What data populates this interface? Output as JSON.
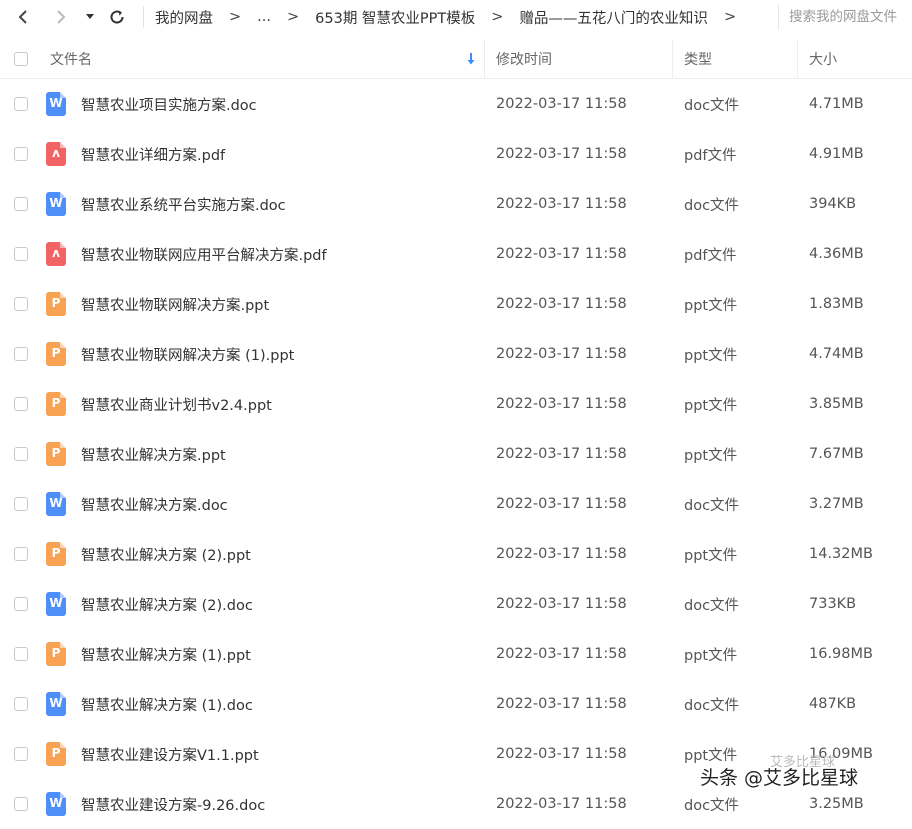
{
  "toolbar": {
    "breadcrumbs": [
      "我的网盘",
      "...",
      "653期 智慧农业PPT模板",
      "赠品——五花八门的农业知识"
    ],
    "separator": ">",
    "search_placeholder": "搜索我的网盘文件"
  },
  "columns": {
    "name": "文件名",
    "modified": "修改时间",
    "type": "类型",
    "size": "大小",
    "sort_icon": "sort-down-arrow-icon"
  },
  "colors": {
    "doc": "#4d8ff7",
    "pdf": "#f26363",
    "ppt": "#f8a254",
    "sort_arrow": "#3b8cff"
  },
  "files": [
    {
      "name": "智慧农业项目实施方案.doc",
      "kind": "doc",
      "modified": "2022-03-17 11:58",
      "type": "doc文件",
      "size": "4.71MB"
    },
    {
      "name": "智慧农业详细方案.pdf",
      "kind": "pdf",
      "modified": "2022-03-17 11:58",
      "type": "pdf文件",
      "size": "4.91MB"
    },
    {
      "name": "智慧农业系统平台实施方案.doc",
      "kind": "doc",
      "modified": "2022-03-17 11:58",
      "type": "doc文件",
      "size": "394KB"
    },
    {
      "name": "智慧农业物联网应用平台解决方案.pdf",
      "kind": "pdf",
      "modified": "2022-03-17 11:58",
      "type": "pdf文件",
      "size": "4.36MB"
    },
    {
      "name": "智慧农业物联网解决方案.ppt",
      "kind": "ppt",
      "modified": "2022-03-17 11:58",
      "type": "ppt文件",
      "size": "1.83MB"
    },
    {
      "name": "智慧农业物联网解决方案 (1).ppt",
      "kind": "ppt",
      "modified": "2022-03-17 11:58",
      "type": "ppt文件",
      "size": "4.74MB"
    },
    {
      "name": "智慧农业商业计划书v2.4.ppt",
      "kind": "ppt",
      "modified": "2022-03-17 11:58",
      "type": "ppt文件",
      "size": "3.85MB"
    },
    {
      "name": "智慧农业解决方案.ppt",
      "kind": "ppt",
      "modified": "2022-03-17 11:58",
      "type": "ppt文件",
      "size": "7.67MB"
    },
    {
      "name": "智慧农业解决方案.doc",
      "kind": "doc",
      "modified": "2022-03-17 11:58",
      "type": "doc文件",
      "size": "3.27MB"
    },
    {
      "name": "智慧农业解决方案 (2).ppt",
      "kind": "ppt",
      "modified": "2022-03-17 11:58",
      "type": "ppt文件",
      "size": "14.32MB"
    },
    {
      "name": "智慧农业解决方案 (2).doc",
      "kind": "doc",
      "modified": "2022-03-17 11:58",
      "type": "doc文件",
      "size": "733KB"
    },
    {
      "name": "智慧农业解决方案 (1).ppt",
      "kind": "ppt",
      "modified": "2022-03-17 11:58",
      "type": "ppt文件",
      "size": "16.98MB"
    },
    {
      "name": "智慧农业解决方案 (1).doc",
      "kind": "doc",
      "modified": "2022-03-17 11:58",
      "type": "doc文件",
      "size": "487KB"
    },
    {
      "name": "智慧农业建设方案V1.1.ppt",
      "kind": "ppt",
      "modified": "2022-03-17 11:58",
      "type": "ppt文件",
      "size": "16.09MB"
    },
    {
      "name": "智慧农业建设方案-9.26.doc",
      "kind": "doc",
      "modified": "2022-03-17 11:58",
      "type": "doc文件",
      "size": "3.25MB"
    }
  ],
  "watermark": {
    "text": "头条 @艾多比星球",
    "ghost_text": "艾多比星球"
  }
}
